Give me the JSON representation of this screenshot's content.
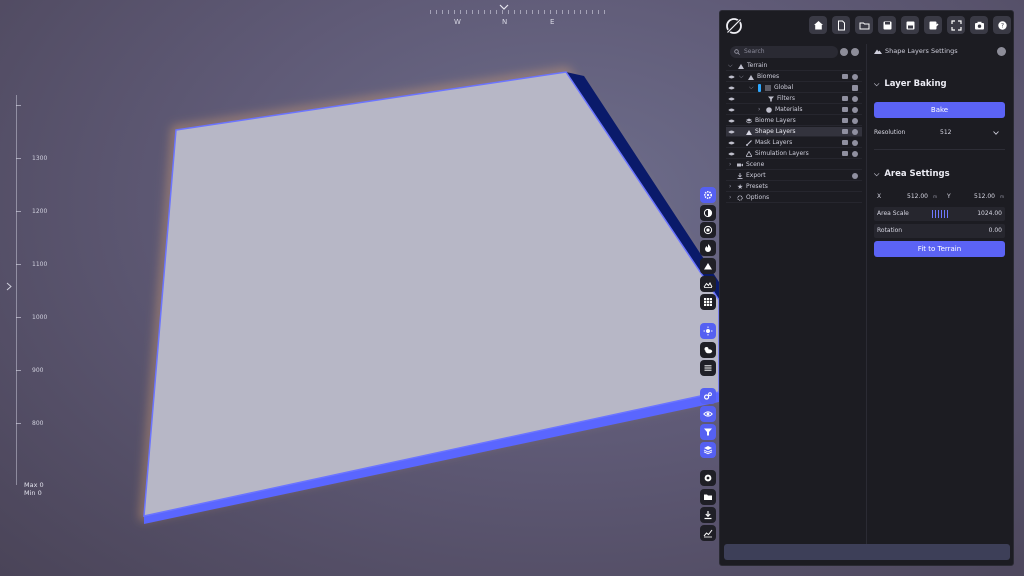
{
  "viewport": {
    "compass": {
      "w": "W",
      "n": "N",
      "e": "E"
    },
    "ruler_marks": [
      "1300",
      "1200",
      "1100",
      "1000",
      "900",
      "800"
    ],
    "max_label": "Max 0",
    "min_label": "Min 0"
  },
  "toolbar": {
    "icons": [
      "home-icon",
      "new-file-icon",
      "open-folder-icon",
      "save-icon",
      "save-as-icon",
      "save-edit-icon",
      "fullscreen-icon",
      "camera-icon",
      "help-icon"
    ]
  },
  "tree": {
    "search_placeholder": "Search",
    "items": [
      {
        "label": "Terrain"
      },
      {
        "label": "Biomes"
      },
      {
        "label": "Global"
      },
      {
        "label": "Filters"
      },
      {
        "label": "Materials"
      },
      {
        "label": "Biome Layers"
      },
      {
        "label": "Shape Layers"
      },
      {
        "label": "Mask Layers"
      },
      {
        "label": "Simulation Layers"
      },
      {
        "label": "Scene"
      },
      {
        "label": "Export"
      },
      {
        "label": "Presets"
      },
      {
        "label": "Options"
      }
    ]
  },
  "settings": {
    "header": "Shape Layers Settings",
    "layer_baking": {
      "title": "Layer Baking",
      "bake_label": "Bake",
      "resolution_label": "Resolution",
      "resolution_value": "512"
    },
    "area_settings": {
      "title": "Area Settings",
      "x_label": "X",
      "x_value": "512.00",
      "y_label": "Y",
      "y_value": "512.00",
      "unit": "m",
      "area_scale_label": "Area Scale",
      "area_scale_value": "1024.00",
      "rotation_label": "Rotation",
      "rotation_value": "0.00",
      "fit_label": "Fit to Terrain"
    }
  },
  "colors": {
    "accent": "#5b63f5",
    "panel": "#1c1c22",
    "terrain_top": "#b7b7c6",
    "terrain_edge": "#5a66ff"
  }
}
